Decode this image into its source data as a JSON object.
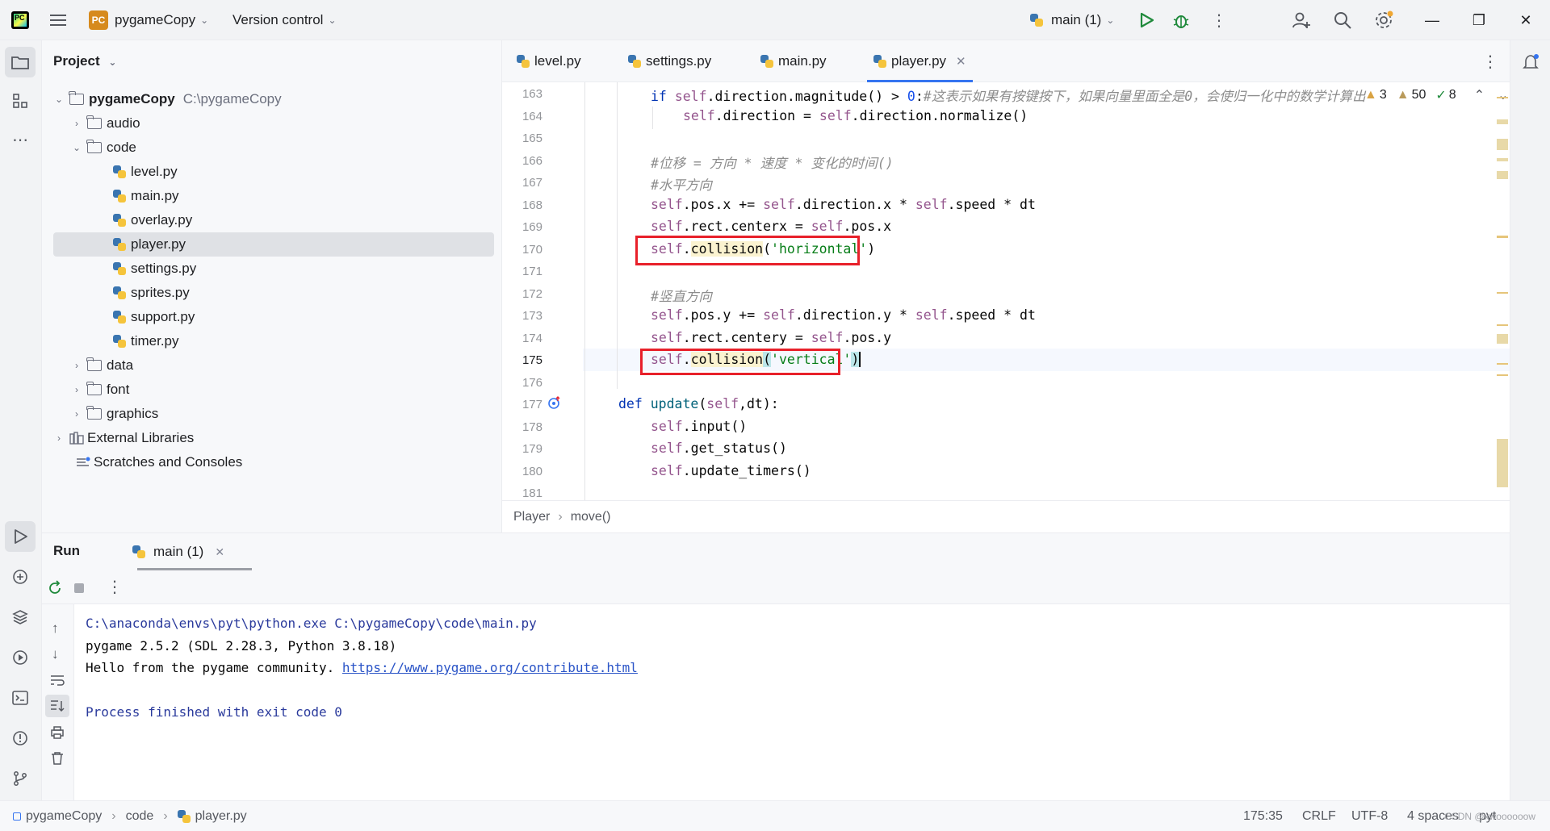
{
  "titlebar": {
    "project_badge": "PC",
    "project_name": "pygameCopy",
    "vcs": "Version control",
    "run_config": "main (1)"
  },
  "project_panel": {
    "title": "Project",
    "root": {
      "name": "pygameCopy",
      "path": "C:\\pygameCopy"
    },
    "items": [
      {
        "label": "audio"
      },
      {
        "label": "code"
      },
      {
        "label": "level.py"
      },
      {
        "label": "main.py"
      },
      {
        "label": "overlay.py"
      },
      {
        "label": "player.py"
      },
      {
        "label": "settings.py"
      },
      {
        "label": "sprites.py"
      },
      {
        "label": "support.py"
      },
      {
        "label": "timer.py"
      },
      {
        "label": "data"
      },
      {
        "label": "font"
      },
      {
        "label": "graphics"
      },
      {
        "label": "External Libraries"
      },
      {
        "label": "Scratches and Consoles"
      }
    ]
  },
  "tabs": [
    {
      "label": "level.py"
    },
    {
      "label": "settings.py"
    },
    {
      "label": "main.py"
    },
    {
      "label": "player.py"
    }
  ],
  "inspections": {
    "warn_a": "3",
    "warn_b": "50",
    "ok": "8"
  },
  "line_numbers": [
    "163",
    "164",
    "165",
    "166",
    "167",
    "168",
    "169",
    "170",
    "171",
    "172",
    "173",
    "174",
    "175",
    "176",
    "177",
    "178",
    "179",
    "180",
    "181"
  ],
  "code": {
    "l163_cmt": "#这表示如果有按键按下，如果向量里面全是0，会使归一化中的数学计算出",
    "l166": "#位移 = 方向 * 速度 * 变化的时间()",
    "l167": "#水平方向",
    "l170_str": "'horizontal'",
    "l172": "#竖直方向",
    "l175_str": "'vertical'"
  },
  "breadcrumb": {
    "class": "Player",
    "method": "move()"
  },
  "run": {
    "title": "Run",
    "tab": "main (1)",
    "output": [
      "C:\\anaconda\\envs\\pyt\\python.exe C:\\pygameCopy\\code\\main.py",
      "pygame 2.5.2 (SDL 2.28.3, Python 3.8.18)",
      "Hello from the pygame community. ",
      "https://www.pygame.org/contribute.html",
      "Process finished with exit code 0"
    ]
  },
  "status": {
    "crumb_project": "pygameCopy",
    "crumb_folder": "code",
    "crumb_file": "player.py",
    "position": "175:35",
    "line_sep": "CRLF",
    "encoding": "UTF-8",
    "indent": "4 spaces",
    "lang": "pyt",
    "watermark": "CSDN @xwoooooow"
  },
  "colors": {
    "accent": "#3574f0",
    "highlight_box": "#e8202a",
    "run_green": "#208a3c"
  }
}
